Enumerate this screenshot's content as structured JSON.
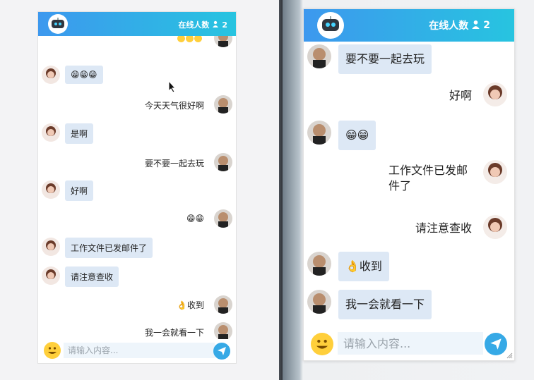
{
  "colors": {
    "header_start": "#3d98ee",
    "header_end": "#27c4e0",
    "incoming_bubble": "#dde8f5",
    "send_button": "#36a9e6"
  },
  "left_window": {
    "online_label": "在线人数",
    "online_count": "2",
    "messages": [
      {
        "side": "right",
        "type": "emoji",
        "text": ""
      },
      {
        "side": "left",
        "type": "emoji",
        "text": "😁😁😁"
      },
      {
        "side": "right",
        "type": "text",
        "text": "今天天气很好啊"
      },
      {
        "side": "left",
        "type": "text",
        "text": "是啊"
      },
      {
        "side": "right",
        "type": "text",
        "text": "要不要一起去玩"
      },
      {
        "side": "left",
        "type": "text",
        "text": "好啊"
      },
      {
        "side": "right",
        "type": "emoji",
        "text": "😁😁"
      },
      {
        "side": "left",
        "type": "text",
        "text": "工作文件已发邮件了"
      },
      {
        "side": "left",
        "type": "text",
        "text": "请注意查收"
      },
      {
        "side": "right",
        "type": "text",
        "text": "👌收到"
      },
      {
        "side": "right",
        "type": "text",
        "text": "我一会就看一下"
      }
    ],
    "input_placeholder": "请输入内容..."
  },
  "right_window": {
    "online_label": "在线人数",
    "online_count": "2",
    "messages": [
      {
        "side": "left",
        "type": "text",
        "text": "要不要一起去玩"
      },
      {
        "side": "right",
        "type": "text",
        "text": "好啊"
      },
      {
        "side": "left",
        "type": "emoji",
        "text": "😁😁"
      },
      {
        "side": "right",
        "type": "text",
        "text": "工作文件已发邮件了"
      },
      {
        "side": "right",
        "type": "text",
        "text": "请注意查收"
      },
      {
        "side": "left",
        "type": "text",
        "text": "👌收到"
      },
      {
        "side": "left",
        "type": "text",
        "text": "我一会就看一下"
      }
    ],
    "input_placeholder": "请输入内容..."
  },
  "icons": {
    "header": "robot-avatar-icon",
    "online": "user-icon",
    "emoji": "smiley-icon",
    "send": "paper-plane-icon"
  }
}
